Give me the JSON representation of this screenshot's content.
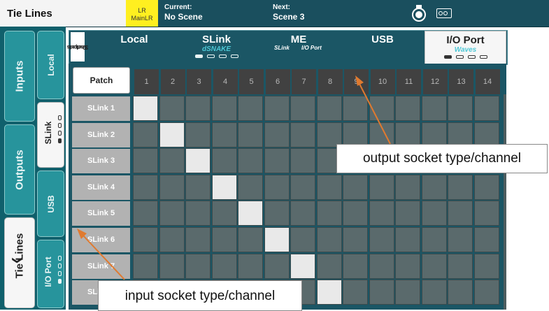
{
  "topbar": {
    "title": "Tie Lines",
    "mix_line1": "LR",
    "mix_line2": "MainLR",
    "current_label": "Current:",
    "current_value": "No Scene",
    "next_label": "Next:",
    "next_value": "Scene 3",
    "icons": [
      "usb-stick-icon",
      "meter-icon"
    ],
    "colors": {
      "bar": "#1a4f5e",
      "badge": "#ffef20"
    }
  },
  "sidebar": {
    "main_tabs": [
      {
        "label": "Inputs",
        "active": false
      },
      {
        "label": "Outputs",
        "active": false
      },
      {
        "label": "Tie Lines",
        "active": true
      }
    ],
    "sub_tabs": [
      {
        "label": "Local",
        "active": false,
        "pages": 0
      },
      {
        "label": "SLink",
        "active": true,
        "pages": 4
      },
      {
        "label": "USB",
        "active": false,
        "pages": 0
      },
      {
        "label": "I/O Port",
        "active": false,
        "pages": 4
      }
    ]
  },
  "socket_bar": {
    "label_line1": "Output",
    "label_line2": "Sockets",
    "types": [
      {
        "name": "Local",
        "sub": "",
        "pages": 0,
        "active": false
      },
      {
        "name": "SLink",
        "sub": "dSNAKE",
        "pages": 4,
        "active": false
      },
      {
        "name": "ME",
        "sub_a": "SLink",
        "sub_b": "I/O Port",
        "pages": 0,
        "active": false
      },
      {
        "name": "USB",
        "sub": "",
        "pages": 0,
        "active": false
      },
      {
        "name": "I/O Port",
        "sub": "Waves",
        "pages": 4,
        "active": true
      }
    ]
  },
  "grid": {
    "patch_button": "Patch",
    "columns": [
      "1",
      "2",
      "3",
      "4",
      "5",
      "6",
      "7",
      "8",
      "9",
      "10",
      "11",
      "12",
      "13",
      "14"
    ],
    "rows": [
      "SLink 1",
      "SLink 2",
      "SLink 3",
      "SLink 4",
      "SLink 5",
      "SLink 6",
      "SLink 7",
      "SLink 8"
    ],
    "patched": [
      [
        0,
        0
      ],
      [
        1,
        1
      ],
      [
        2,
        2
      ],
      [
        3,
        3
      ],
      [
        4,
        4
      ],
      [
        5,
        5
      ],
      [
        6,
        6
      ],
      [
        7,
        7
      ]
    ]
  },
  "callouts": {
    "output": "output socket type/channel",
    "input": "input socket type/channel",
    "color": "#e07a2f"
  }
}
